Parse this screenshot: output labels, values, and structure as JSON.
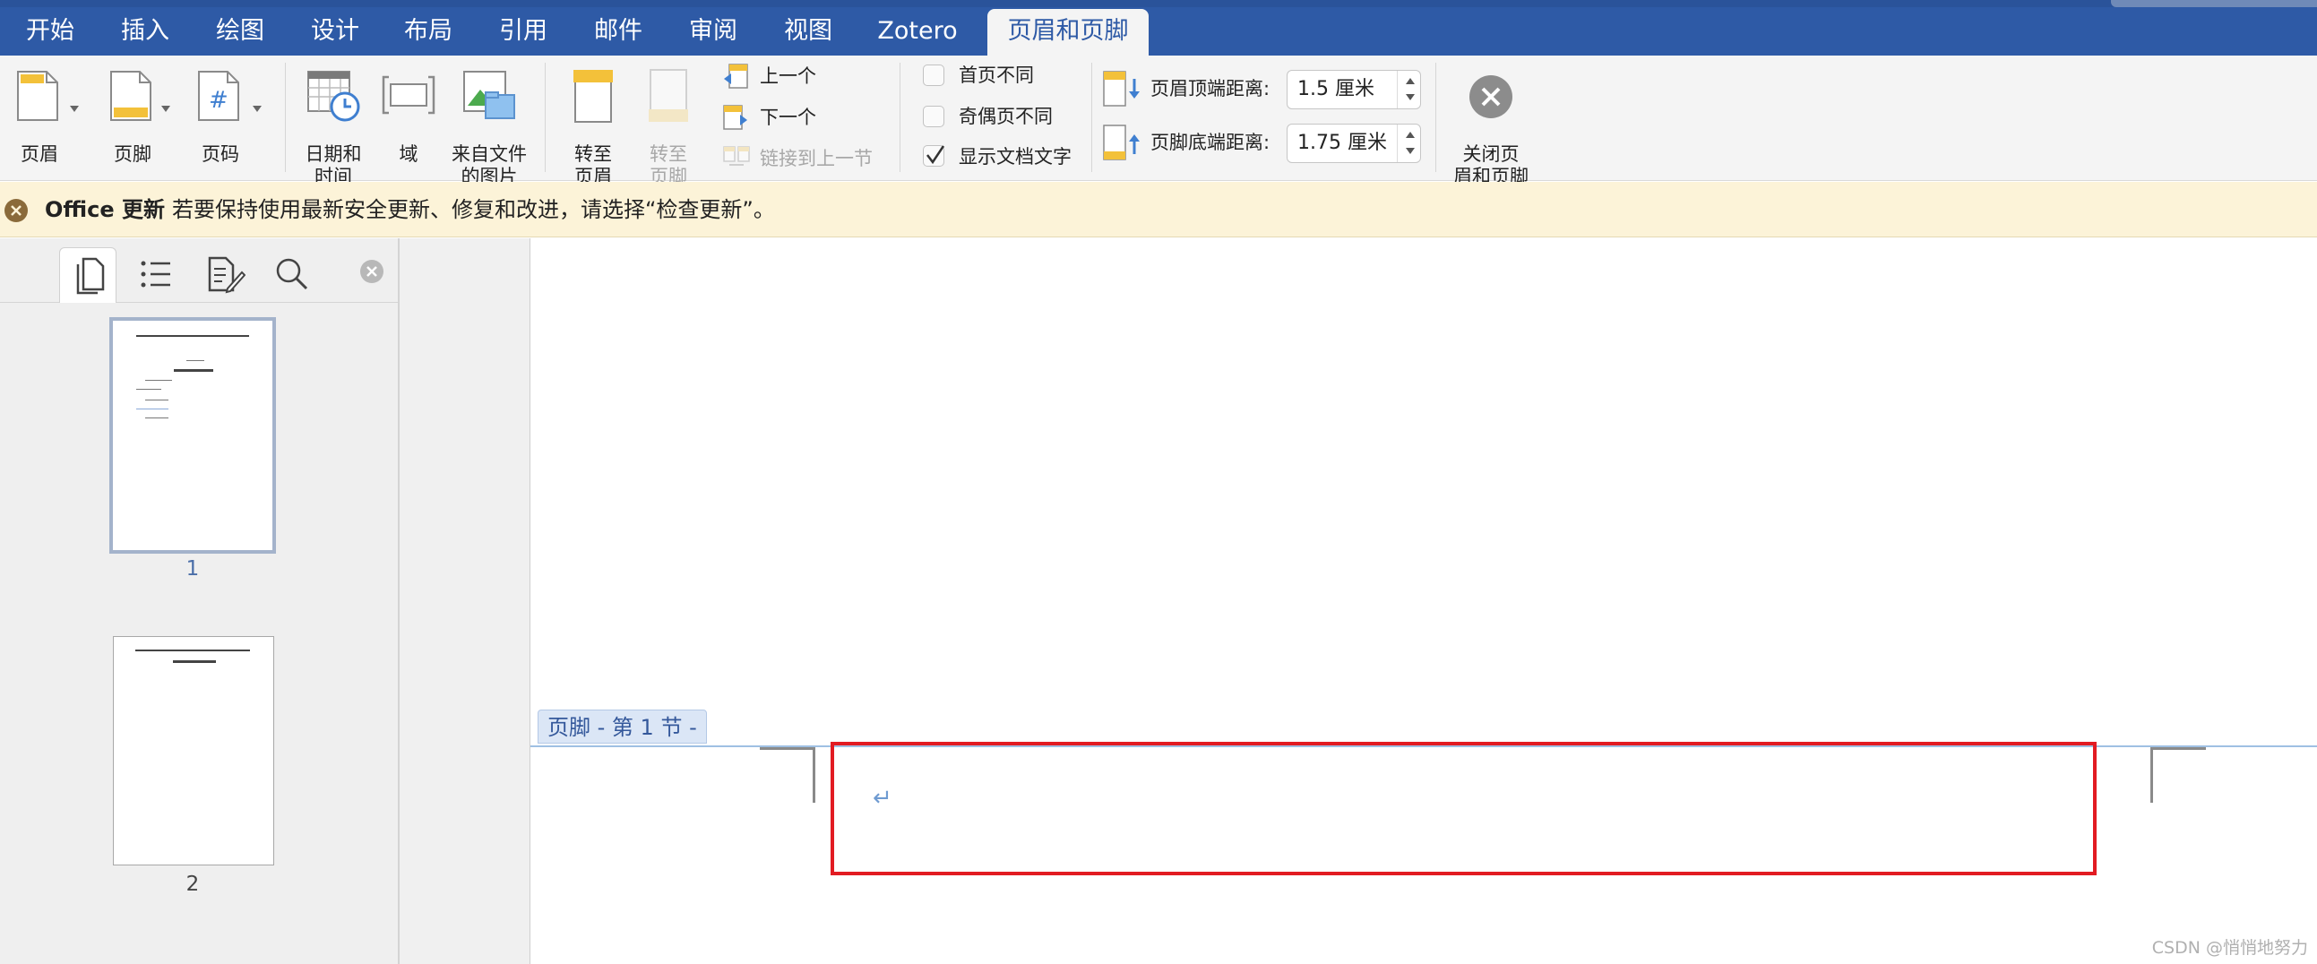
{
  "tabs": [
    {
      "label": "开始",
      "active": false
    },
    {
      "label": "插入",
      "active": false
    },
    {
      "label": "绘图",
      "active": false
    },
    {
      "label": "设计",
      "active": false
    },
    {
      "label": "布局",
      "active": false
    },
    {
      "label": "引用",
      "active": false
    },
    {
      "label": "邮件",
      "active": false
    },
    {
      "label": "审阅",
      "active": false
    },
    {
      "label": "视图",
      "active": false
    },
    {
      "label": "Zotero",
      "active": false
    },
    {
      "label": "页眉和页脚",
      "active": true
    }
  ],
  "toolbar": {
    "header_label": "页眉",
    "footer_label": "页脚",
    "page_number_label": "页码",
    "date_time_label_line1": "日期和",
    "date_time_label_line2": "时间",
    "field_label": "域",
    "picture_label_line1": "来自文件",
    "picture_label_line2": "的图片",
    "goto_header_line1": "转至",
    "goto_header_line2": "页眉",
    "goto_footer_line1": "转至",
    "goto_footer_line2": "页脚",
    "previous_label": "上一个",
    "next_label": "下一个",
    "link_previous_label": "链接到上一节",
    "different_first_page_label": "首页不同",
    "different_first_page_checked": false,
    "different_odd_even_label": "奇偶页不同",
    "different_odd_even_checked": false,
    "show_document_text_label": "显示文档文字",
    "show_document_text_checked": true,
    "header_from_top_label": "页眉顶端距离:",
    "header_from_top_value": "1.5 厘米",
    "footer_from_bottom_label": "页脚底端距离:",
    "footer_from_bottom_value": "1.75 厘米",
    "close_line1": "关闭页",
    "close_line2": "眉和页脚"
  },
  "update_bar": {
    "title": "Office 更新",
    "message": "若要保持使用最新安全更新、修复和改进，请选择“检查更新”。"
  },
  "sidebar": {
    "tabs": [
      "thumbnails-icon",
      "outline-icon",
      "review-icon",
      "search-icon"
    ],
    "pages": [
      {
        "number": "1",
        "selected": true
      },
      {
        "number": "2",
        "selected": false
      }
    ]
  },
  "document": {
    "footer_label": "页脚 - 第 1 节 -",
    "paragraph_mark": "↵"
  },
  "watermark": "CSDN @悄悄地努力",
  "colors": {
    "ribbon_blue": "#2e5aa6",
    "toolbar_bg": "#f4f4f4",
    "update_bar_bg": "#fcf3d8",
    "highlight_red": "#e21b22",
    "footer_label_bg": "#dbe6f6"
  }
}
